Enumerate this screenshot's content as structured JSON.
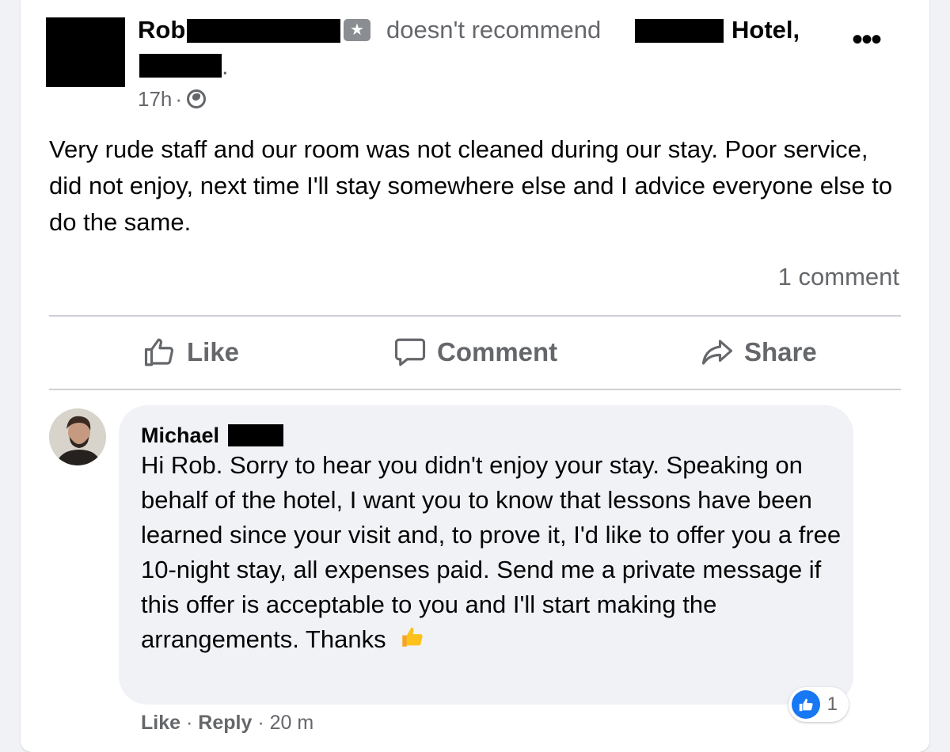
{
  "post": {
    "author_first_name": "Rob",
    "recommend_text": "doesn't recommend",
    "hotel_label": "Hotel,",
    "period": ".",
    "time": "17h",
    "separator": "·",
    "body": "Very rude staff and our room was not cleaned during our stay. Poor service, did not enjoy, next time I'll stay somewhere else and I advice everyone else to do the same.",
    "comment_count": "1 comment",
    "more_label": "•••"
  },
  "actions": {
    "like": "Like",
    "comment": "Comment",
    "share": "Share"
  },
  "comment": {
    "author_first_name": "Michael",
    "text": "Hi Rob. Sorry to hear you didn't enjoy your stay. Speaking on behalf of the hotel, I want you to know that lessons have been learned since your visit and, to prove it, I'd like to offer you a free 10-night stay, all expenses paid. Send me a private message if this offer is acceptable to you and I'll start making the arrangements. Thanks",
    "reaction_count": "1",
    "like_label": "Like",
    "reply_label": "Reply",
    "separator": "·",
    "time": "20 m"
  },
  "colors": {
    "accent": "#1877f2",
    "secondary_text": "#65676b",
    "bubble_bg": "#f0f2f5"
  },
  "icons": [
    "globe-icon",
    "recommend-badge-icon",
    "more-options-icon",
    "like-icon",
    "comment-icon",
    "share-icon",
    "thumbs-up-emoji-icon",
    "like-reaction-icon"
  ]
}
